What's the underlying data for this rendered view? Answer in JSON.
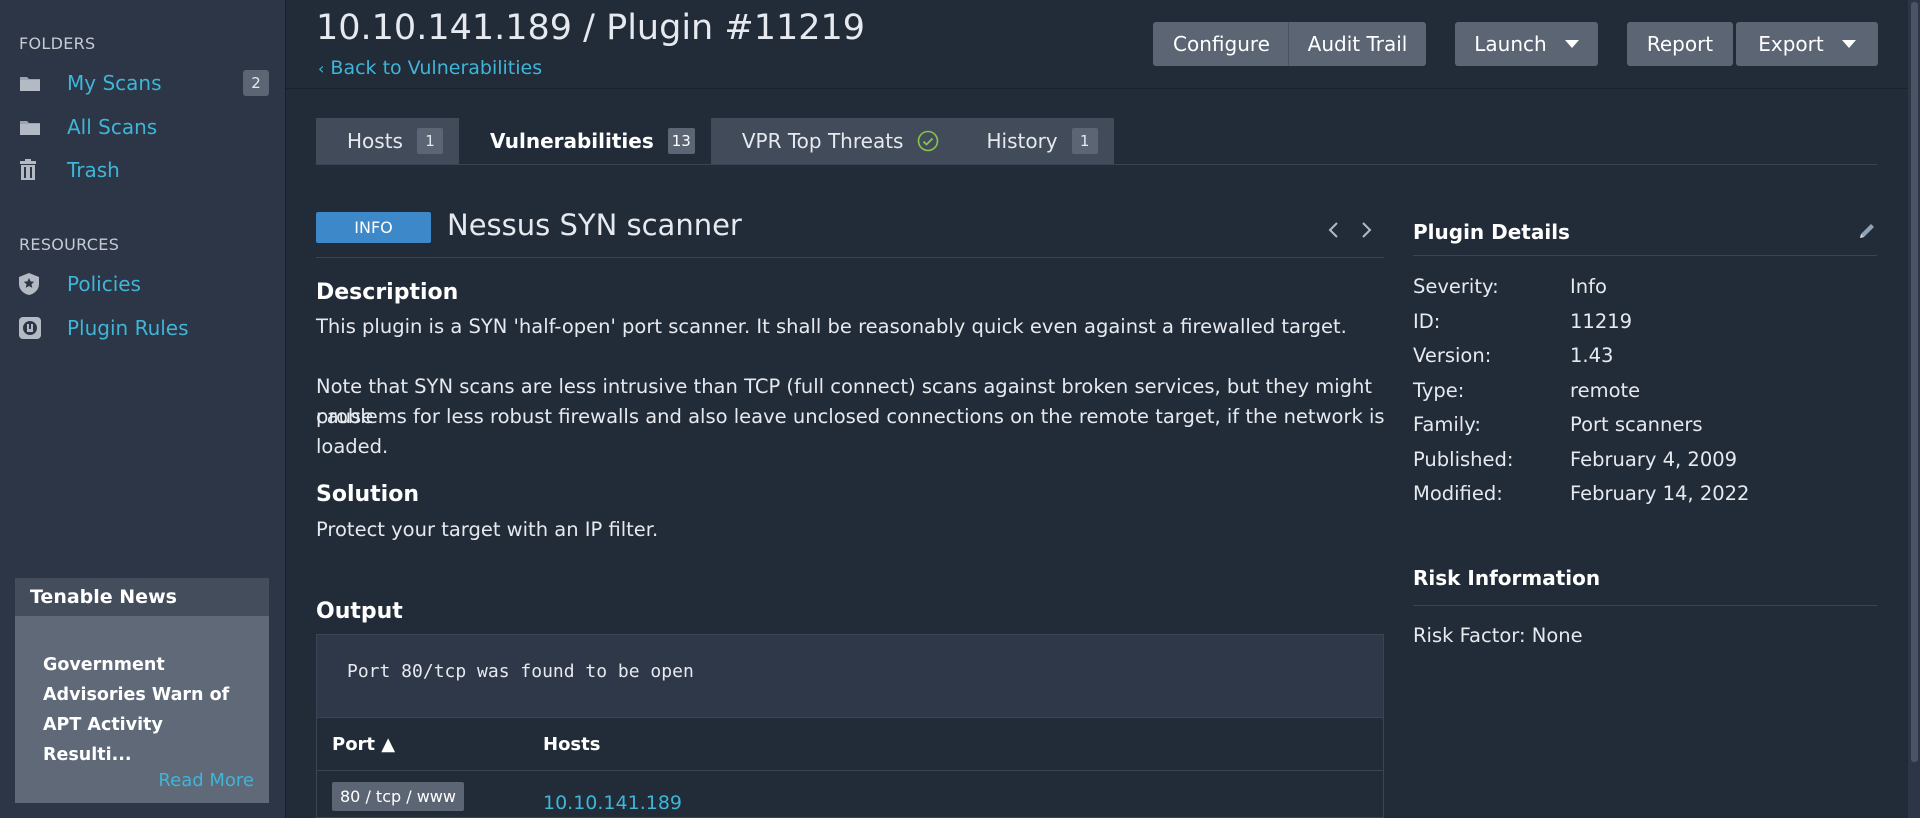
{
  "sidebar": {
    "folders_heading": "FOLDERS",
    "folders": [
      {
        "label": "My Scans",
        "count": "2",
        "icon": "folder-icon"
      },
      {
        "label": "All Scans",
        "icon": "folder-icon"
      },
      {
        "label": "Trash",
        "icon": "trash-icon"
      }
    ],
    "resources_heading": "RESOURCES",
    "resources": [
      {
        "label": "Policies",
        "icon": "shield-star-icon"
      },
      {
        "label": "Plugin Rules",
        "icon": "plug-icon"
      }
    ],
    "news": {
      "title": "Tenable News",
      "headline": "Government Advisories Warn of APT Activity Resulti...",
      "read_more": "Read More"
    }
  },
  "header": {
    "title": "10.10.141.189 / Plugin #11219",
    "back_link": "Back to Vulnerabilities",
    "buttons": {
      "configure": "Configure",
      "audit_trail": "Audit Trail",
      "launch": "Launch",
      "report": "Report",
      "export": "Export"
    }
  },
  "tabs": [
    {
      "label": "Hosts",
      "count": "1"
    },
    {
      "label": "Vulnerabilities",
      "count": "13",
      "active": true
    },
    {
      "label": "VPR Top Threats",
      "icon": "check-circle-icon"
    },
    {
      "label": "History",
      "count": "1"
    }
  ],
  "plugin": {
    "severity_badge": "INFO",
    "name": "Nessus SYN scanner",
    "description_heading": "Description",
    "description_p1": "This plugin is a SYN 'half-open' port scanner. It shall be reasonably quick even against a firewalled target.",
    "description_p2_line1": "Note that SYN scans are less intrusive than TCP (full connect) scans against broken services, but they might cause",
    "description_p2_line2": "problems for less robust firewalls and also leave unclosed connections on the remote target, if the network is loaded.",
    "solution_heading": "Solution",
    "solution": "Protect your target with an IP filter.",
    "output_heading": "Output",
    "output_text": "Port 80/tcp was found to be open",
    "table": {
      "col_port": "Port ▲",
      "col_hosts": "Hosts",
      "rows": [
        {
          "port": "80 / tcp / www",
          "host": "10.10.141.189"
        }
      ]
    }
  },
  "details": {
    "heading": "Plugin Details",
    "rows": [
      {
        "key": "Severity:",
        "value": "Info"
      },
      {
        "key": "ID:",
        "value": "11219"
      },
      {
        "key": "Version:",
        "value": "1.43"
      },
      {
        "key": "Type:",
        "value": "remote"
      },
      {
        "key": "Family:",
        "value": "Port scanners"
      },
      {
        "key": "Published:",
        "value": "February 4, 2009"
      },
      {
        "key": "Modified:",
        "value": "February 14, 2022"
      }
    ],
    "risk_heading": "Risk Information",
    "risk_factor": "Risk Factor: None"
  },
  "colors": {
    "background": "#222b38",
    "sidebar": "#2c3646",
    "accent_link": "#3fb5d8",
    "info_badge": "#3d88c8",
    "button": "#5c6573"
  }
}
